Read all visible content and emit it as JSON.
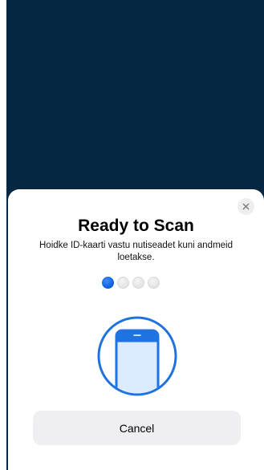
{
  "scan_sheet": {
    "title": "Ready to Scan",
    "instruction": "Hoidke ID-kaarti vastu nutiseadet kuni andmeid loetakse.",
    "close_icon": "close-icon",
    "illustration_icon": "phone-icon",
    "progress": {
      "current_step": 1,
      "total_steps": 4
    },
    "cancel_label": "Cancel"
  },
  "colors": {
    "backdrop": "#062742",
    "accent": "#0a5bd8",
    "sheet": "#ffffff",
    "button_bg": "#efeff1"
  }
}
